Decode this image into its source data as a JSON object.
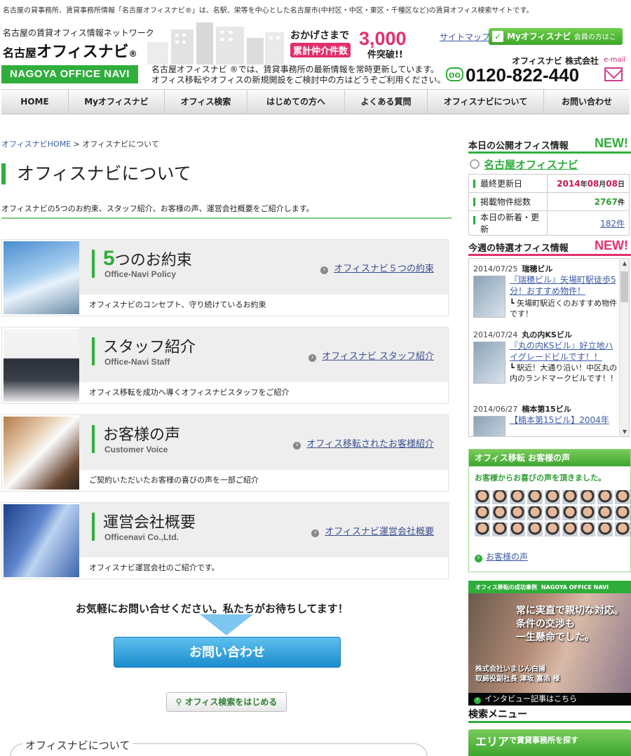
{
  "top_line": "名古屋の貸事務所、賃貸事務所情報「名古屋オフィスナビ®」は、名駅、栄等を中心とした名古屋市(中村区・中区・東区・千種区など)の賃貸オフィス検索サイトです。",
  "header": {
    "logo_sub": "名古屋の賃貸オフィス情報ネットワーク",
    "logo_small": "名古屋",
    "logo_main": "オフィスナビ",
    "logo_reg": "®",
    "logo_en": "NAGOYA OFFICE NAVI",
    "promo_line1": "おかげさまで",
    "promo_line2": "累計仲介件数",
    "promo_number": "3,000",
    "promo_line3": "件突破!!",
    "sitemap": "サイトマップ",
    "my_button": "Myオフィスナビ",
    "my_button_sub": "会員の方はこちら",
    "intro_line1": "名古屋オフィスナビ ®では、賃貸事務所の最新情報を常時更新しています。",
    "intro_line2": "オフィス移転やオフィスの新規開設をご検討中の方はどうぞご利用ください。",
    "company": "オフィスナビ 株式会社",
    "email_label": "e-mail",
    "tel_badge": "oo",
    "tel": "0120-822-440"
  },
  "nav": [
    "HOME",
    "Myオフィスナビ",
    "オフィス検索",
    "はじめての方へ",
    "よくある質問",
    "オフィスナビについて",
    "お問い合わせ"
  ],
  "breadcrumb": {
    "home": "オフィスナビHOME",
    "sep": " > ",
    "current": "オフィスナビについて"
  },
  "page_title": "オフィスナビについて",
  "lead": "オフィスナビの5つのお約束、スタッフ紹介、お客様の声、運営会社概要をご紹介します。",
  "cards": [
    {
      "num": "5",
      "title": "つのお約束",
      "sub": "Office-Navi Policy",
      "link": "オフィスナビ５つの約束",
      "desc": "オフィスナビのコンセプト、守り続けているお約束"
    },
    {
      "num": "",
      "title": "スタッフ紹介",
      "sub": "Office-Navi Staff",
      "link": "オフィスナビ スタッフ紹介",
      "desc": "オフィス移転を成功へ導くオフィスナビスタッフをご紹介"
    },
    {
      "num": "",
      "title": "お客様の声",
      "sub": "Customer Voice",
      "link": "オフィス移転されたお客様紹介",
      "desc": "ご契約いただいたお客様の喜びの声を一部ご紹介"
    },
    {
      "num": "",
      "title": "運営会社概要",
      "sub": "Officenavi Co.,Ltd.",
      "link": "オフィスナビ運営会社概要",
      "desc": "オフィスナビ運営会社のご紹介です。"
    }
  ],
  "cta": {
    "line": "お気軽にお問い合せください。私たちがお待ちしてます！",
    "button": "お問い合わせ",
    "search_button": "オフィス検索をはじめる"
  },
  "about_box_title": "オフィスナビについて",
  "sidebar": {
    "today_title": "本日の公開オフィス情報",
    "new_label": "NEW!",
    "nagoya_link": "名古屋オフィスナビ",
    "stats": [
      {
        "label": "最終更新日",
        "y": "2014",
        "yu": "年",
        "m": "08",
        "mu": "月",
        "d": "08",
        "du": "日"
      },
      {
        "label": "掲載物件総数",
        "value": "2767",
        "unit": "件"
      },
      {
        "label": "本日の新着・更新",
        "value": "182件"
      }
    ],
    "weekly_title": "今週の特選オフィス情報",
    "feed": [
      {
        "date": "2014/07/25",
        "name": "瑞穂ビル",
        "title": "『瑞穂ビル』矢場町駅徒歩5分！おすすめ物件！",
        "summary": "┗ 矢場町駅近くのおすすめ物件です！"
      },
      {
        "date": "2014/07/24",
        "name": "丸の内KSビル",
        "title": "『丸の内KSビル』好立地ハイグレードビルです！！",
        "summary": "┗ 駅近！大通り沿い！中区丸の内のランドマークビルです！！"
      },
      {
        "date": "2014/06/27",
        "name": "楠本第15ビル",
        "title": "【楠本第15ビル】2004年",
        "summary": ""
      }
    ],
    "voice_header": "オフィス移転 お客様の声",
    "voice_sub": "お客様からお喜びの声を頂きました。",
    "voice_link": "お客様の声",
    "success_header": "オフィス移転の成功事例",
    "success_header_en": "NAGOYA OFFICE NAVI",
    "success_quote": [
      "常に実直で親切な対応。",
      "条件の交渉も",
      "一生懸命でした。"
    ],
    "success_who": [
      "株式会社いまじん白揚",
      "取締役副社長 津坂 富浩 様"
    ],
    "success_link": "インタビュー記事はこちら",
    "search_menu": "検索メニュー",
    "area_title": "エリア",
    "area_sub": "で賃貸事務所を探す"
  },
  "colors": {
    "accent_green": "#2fae3c",
    "accent_pink": "#e3306a",
    "link_blue": "#3c5aa6",
    "cta_blue": "#1b8ccd"
  }
}
